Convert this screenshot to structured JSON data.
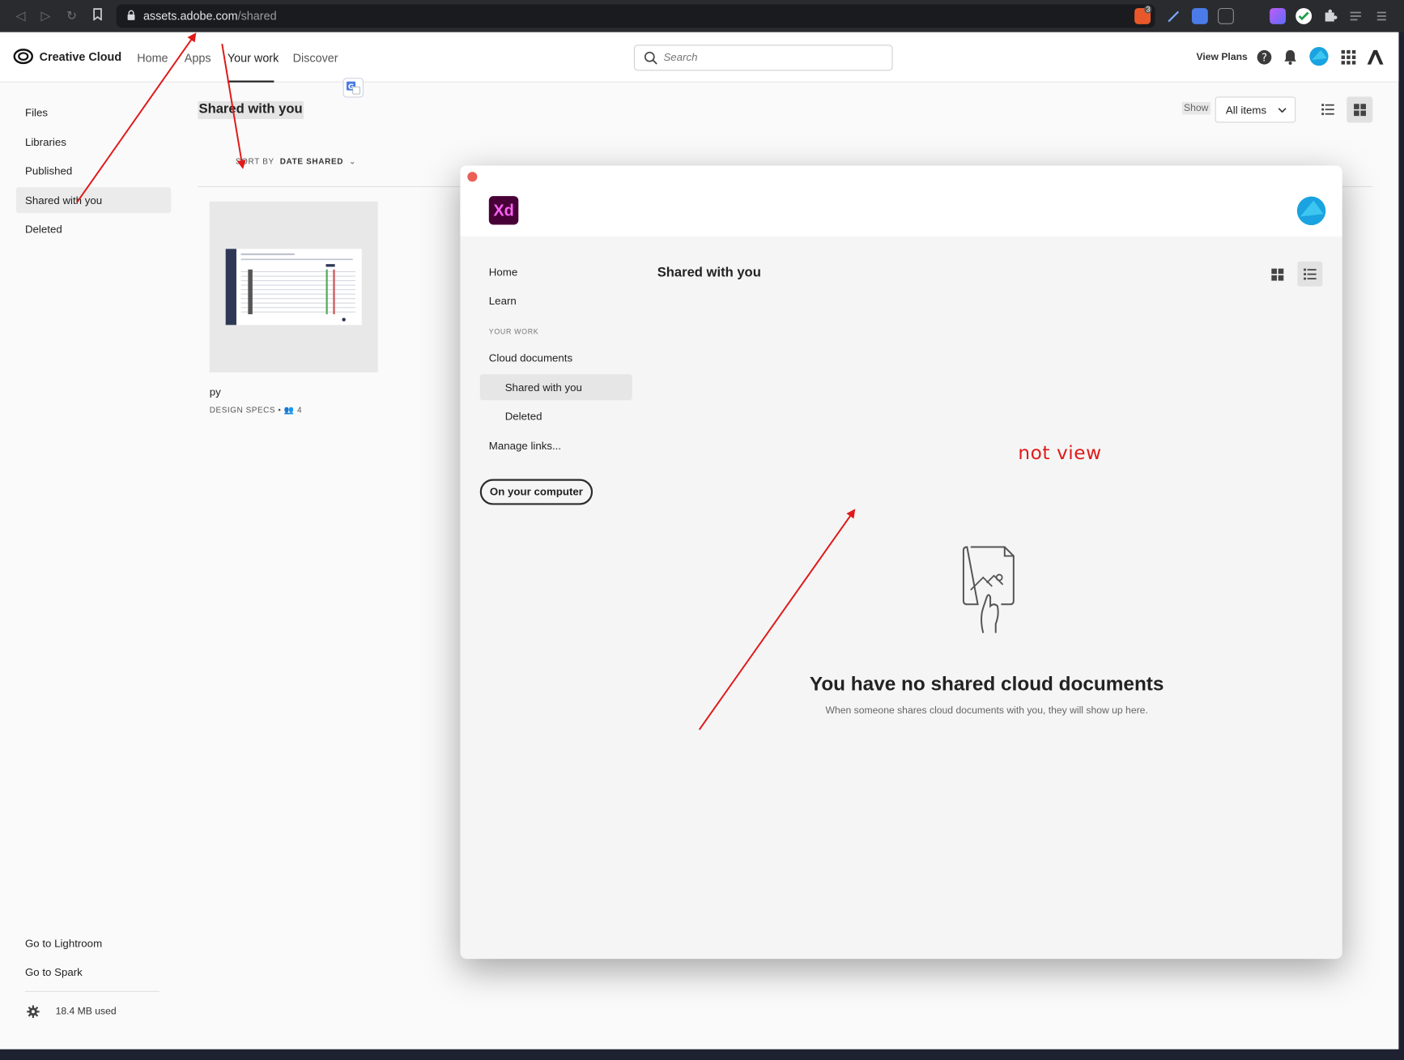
{
  "browser": {
    "url_host": "assets.adobe.com",
    "url_path": "/shared",
    "ext_badge": "3"
  },
  "header": {
    "brand": "Creative Cloud",
    "nav": [
      "Home",
      "Apps",
      "Your work",
      "Discover"
    ],
    "search_placeholder": "Search",
    "view_plans": "View Plans"
  },
  "sidebar": {
    "items": [
      "Files",
      "Libraries",
      "Published",
      "Shared with you",
      "Deleted"
    ],
    "bottom_links": [
      "Go to Lightroom",
      "Go to Spark"
    ],
    "storage": "18.4 MB used"
  },
  "main": {
    "title": "Shared with you",
    "show_label": "Show",
    "filter_value": "All items",
    "sort_prefix": "SORT BY",
    "sort_value": "DATE SHARED",
    "card": {
      "title": "py",
      "type": "DESIGN SPECS",
      "collaborators": "4"
    }
  },
  "xd_window": {
    "logo": "Xd",
    "nav": [
      "Home",
      "Learn"
    ],
    "section_label": "YOUR WORK",
    "work_items": [
      "Cloud documents",
      "Shared with you",
      "Deleted"
    ],
    "manage_links": "Manage links...",
    "on_computer": "On your computer",
    "heading": "Shared with you",
    "empty_title": "You have no shared cloud documents",
    "empty_subtitle": "When someone shares cloud documents with you, they will show up here."
  },
  "annotation": "not view",
  "colors": {
    "accent": "#e01a1a",
    "xd_purple": "#470137",
    "xd_pink": "#ff61f6"
  }
}
